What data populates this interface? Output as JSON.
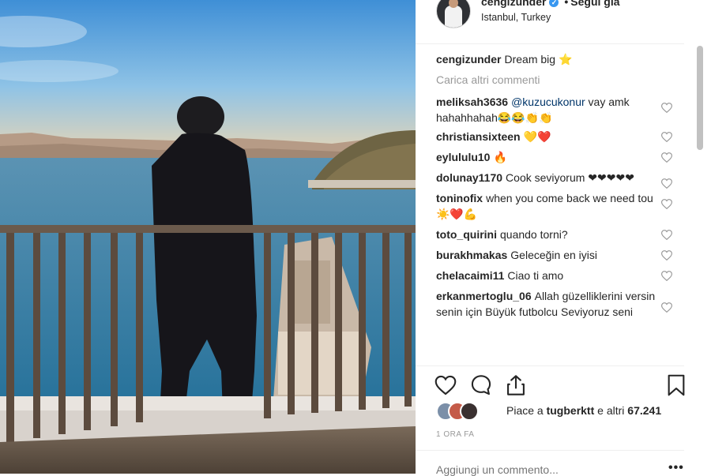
{
  "post": {
    "username": "cengizunder",
    "follow_state": "Seguì già",
    "dot": "•",
    "location": "Istanbul, Turkey"
  },
  "caption": {
    "username": "cengizunder",
    "text": "Dream big ⭐"
  },
  "load_more": "Carica altri commenti",
  "comments": [
    {
      "username": "meliksah3636",
      "mention": "@kuzucukonur",
      "text": " vay amk hahahhahah😂😂👏👏"
    },
    {
      "username": "christiansixteen",
      "text": "💛❤️"
    },
    {
      "username": "eylululu10",
      "text": "🔥"
    },
    {
      "username": "dolunay1170",
      "text": "Cook seviyorum ❤❤❤❤❤"
    },
    {
      "username": "toninofix",
      "text": "when you come back we need tou ☀️❤️💪"
    },
    {
      "username": "toto_quirini",
      "text": "quando torni?"
    },
    {
      "username": "burakhmakas",
      "text": "Geleceğin en iyisi"
    },
    {
      "username": "chelacaimi11",
      "text": "Ciao ti amo"
    },
    {
      "username": "erkanmertoglu_06",
      "text": "Allah güzelliklerini versin senin için Büyük futbolcu Seviyoruz seni"
    }
  ],
  "likes": {
    "prefix": "Piace a ",
    "user": "tugberktt",
    "middle": " e altri ",
    "count": "67.241"
  },
  "time": "1 ORA FA",
  "add_comment_placeholder": "Aggiungi un commento...",
  "more_dots": "•••",
  "icons": {
    "like": "heart-outline-icon",
    "comment": "comment-bubble-icon",
    "share": "share-icon",
    "save": "bookmark-icon"
  },
  "colors": {
    "link": "#003569",
    "muted": "#999999",
    "verified": "#3897f0"
  }
}
